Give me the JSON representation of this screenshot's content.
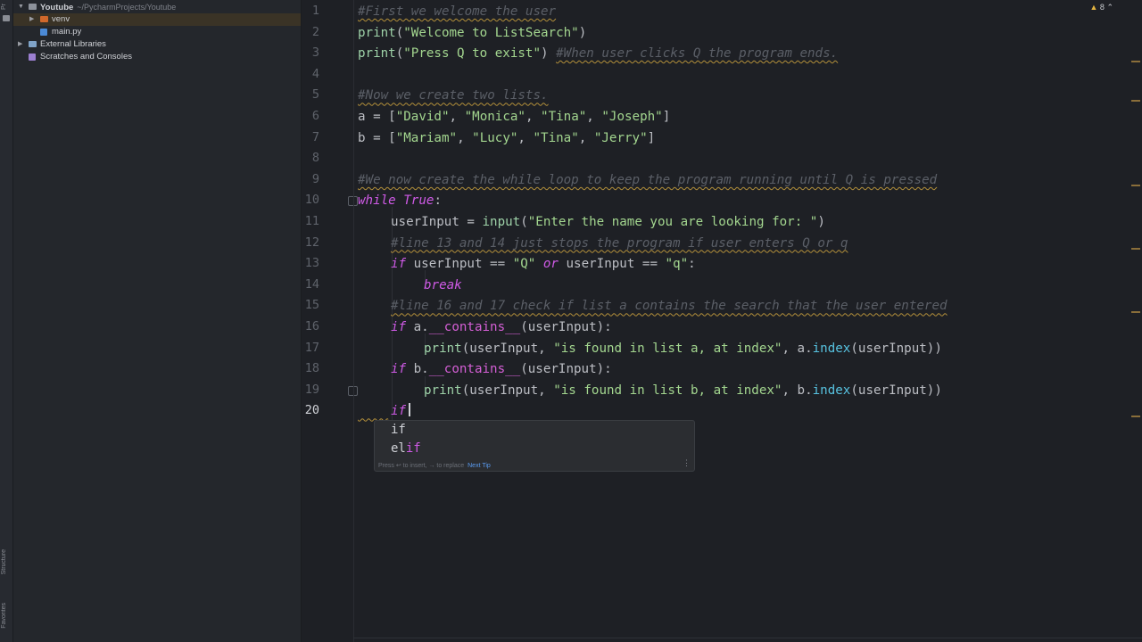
{
  "toolstrip": {
    "top_label": "Pr",
    "bottom_labels": [
      "Structure",
      "Favorites"
    ]
  },
  "project": {
    "root": {
      "name": "Youtube",
      "path": "~/PycharmProjects/Youtube"
    },
    "items": [
      {
        "name": "venv"
      },
      {
        "name": "main.py"
      },
      {
        "name": "External Libraries"
      },
      {
        "name": "Scratches and Consoles"
      }
    ]
  },
  "editor": {
    "line_numbers": [
      "1",
      "2",
      "3",
      "4",
      "5",
      "6",
      "7",
      "8",
      "9",
      "10",
      "11",
      "12",
      "13",
      "14",
      "15",
      "16",
      "17",
      "18",
      "19",
      "20"
    ],
    "active_line": "20",
    "lines": {
      "l1": {
        "comment": "#First we welcome the user"
      },
      "l2": {
        "fn": "print",
        "open": "(",
        "str": "\"Welcome to ListSearch\"",
        "close": ")"
      },
      "l3": {
        "fn": "print",
        "open": "(",
        "str": "\"Press Q to exist\"",
        "close": ")",
        "comment": "#When user clicks Q the program ends."
      },
      "l5": {
        "comment": "#Now we create two lists."
      },
      "l6": {
        "text": "a = [",
        "s1": "\"David\"",
        "s2": "\"Monica\"",
        "s3": "\"Tina\"",
        "s4": "\"Joseph\"",
        "end": "]",
        "sep": ", "
      },
      "l7": {
        "text": "b = [",
        "s1": "\"Mariam\"",
        "s2": "\"Lucy\"",
        "s3": "\"Tina\"",
        "s4": "\"Jerry\"",
        "end": "]",
        "sep": ", "
      },
      "l9": {
        "comment": "#We now create the while loop to keep the program running until Q is pressed"
      },
      "l10": {
        "kw": "while",
        "kw2": "True",
        "end": ":"
      },
      "l11": {
        "pre": "userInput = ",
        "fn": "input",
        "open": "(",
        "str": "\"Enter the name you are looking for: \"",
        "close": ")"
      },
      "l12": {
        "comment": "#line 13 and 14 just stops the program if user enters Q or q"
      },
      "l13": {
        "kw": "if",
        "a": " userInput == ",
        "s1": "\"Q\"",
        "kw2": "or",
        "b": " userInput == ",
        "s2": "\"q\"",
        "end": ":"
      },
      "l14": {
        "kw": "break"
      },
      "l15": {
        "comment": "#line 16 and 17 check if list a contains the search that the user entered"
      },
      "l16": {
        "kw": "if",
        "obj": " a.",
        "dunder": "__contains__",
        "rest": "(userInput):"
      },
      "l17": {
        "fn": "print",
        "pre": "(userInput, ",
        "str": "\"is found in list a, at index\"",
        "mid": ", a.",
        "method": "index",
        "post": "(userInput))"
      },
      "l18": {
        "kw": "if",
        "obj": " b.",
        "dunder": "__contains__",
        "rest": "(userInput):"
      },
      "l19": {
        "fn": "print",
        "pre": "(userInput, ",
        "str": "\"is found in list b, at index\"",
        "mid": ", b.",
        "method": "index",
        "post": "(userInput))"
      },
      "l20": {
        "kw": "if"
      }
    }
  },
  "completion": {
    "items": [
      {
        "prefix": "",
        "match": "if"
      },
      {
        "prefix": "el",
        "match": "if"
      }
    ],
    "footer": "Press ↩ to insert, → to replace",
    "tip": "Next Tip",
    "menu": "⋮"
  },
  "status": {
    "warnings_count": "8"
  },
  "colors": {
    "background": "#1e2025",
    "keyword": "#cf5ae6",
    "string": "#a3d68f",
    "function": "#57c2e0",
    "comment": "#5b5f67",
    "warning": "#b4903a"
  }
}
